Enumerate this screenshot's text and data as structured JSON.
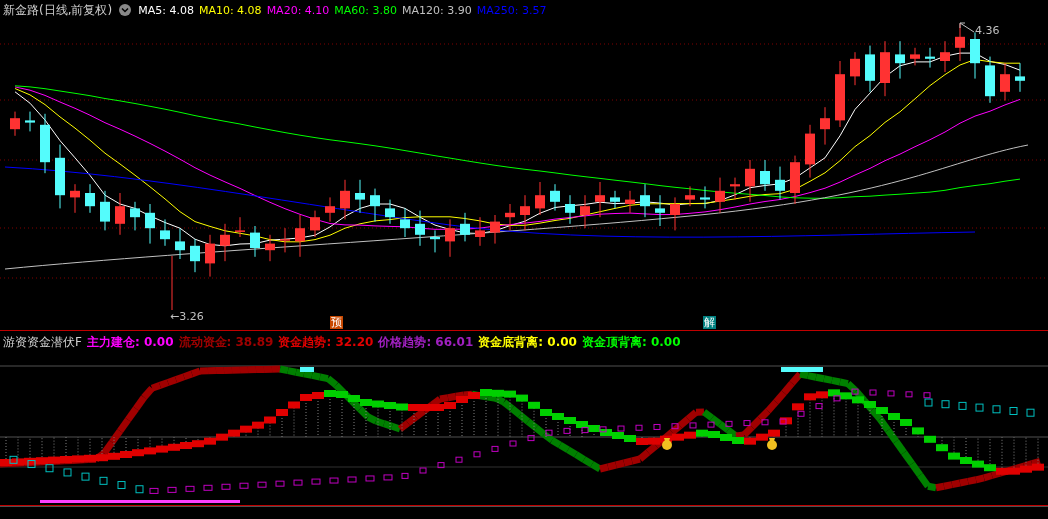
{
  "main_panel": {
    "title": "新金路(日线,前复权)",
    "legend": [
      {
        "text": "MA5: 4.08",
        "color": "#ffffff"
      },
      {
        "text": "MA10: 4.08",
        "color": "#ffff00"
      },
      {
        "text": "MA20: 4.10",
        "color": "#ff00ff"
      },
      {
        "text": "MA60: 3.80",
        "color": "#00ff00"
      },
      {
        "text": "MA120: 3.90",
        "color": "#c0c0c0"
      },
      {
        "text": "MA250: 3.57",
        "color": "#0000ff"
      }
    ],
    "high_label": "4.36",
    "low_label": "←3.26",
    "signals": [
      {
        "text": "预",
        "kind": "forecast"
      },
      {
        "text": "解",
        "kind": "release"
      }
    ]
  },
  "indicator_panel": {
    "title": "游资资金潜伏F",
    "legend": [
      {
        "text": "主力建仓: 0.00",
        "color": "#ff00ff"
      },
      {
        "text": "流动资金: 38.89",
        "color": "#a00000"
      },
      {
        "text": "资金趋势: 32.20",
        "color": "#e00000"
      },
      {
        "text": "价格趋势: 66.01",
        "color": "#a020c0"
      },
      {
        "text": "资金底背离: 0.00",
        "color": "#ffff00"
      },
      {
        "text": "资金顶背离: 0.00",
        "color": "#00ff00"
      }
    ]
  }
}
